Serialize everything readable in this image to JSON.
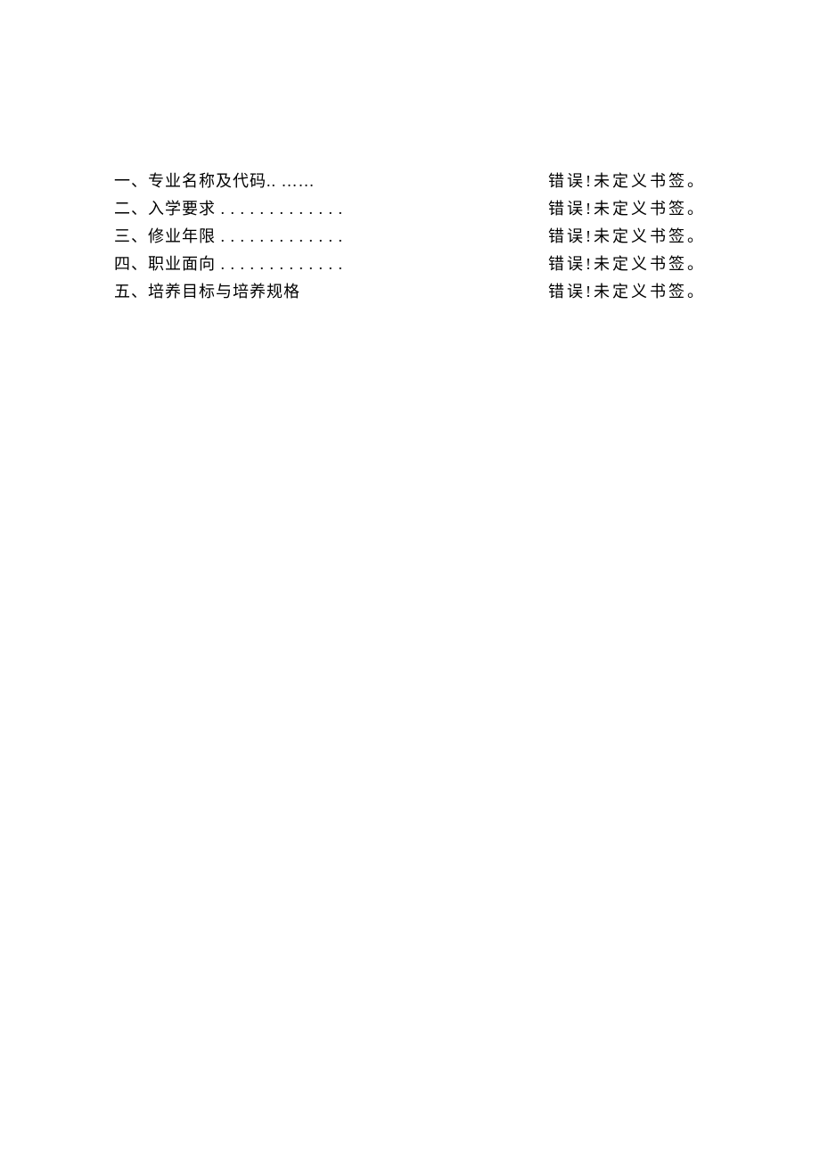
{
  "toc": [
    {
      "label": "一、专业名称及代码.. ……",
      "error": "错误!未定义书签。"
    },
    {
      "label": "二、入学要求 . . . . . . . . . . . . .",
      "error": "错误!未定义书签。"
    },
    {
      "label": "三、修业年限 . . . . . . . . . . . . .",
      "error": "错误!未定义书签。"
    },
    {
      "label": "四、职业面向 . . . . . . . . . . . . .",
      "error": "错误!未定义书签。"
    },
    {
      "label": "五、培养目标与培养规格",
      "error": "错误!未定义书签。"
    }
  ]
}
